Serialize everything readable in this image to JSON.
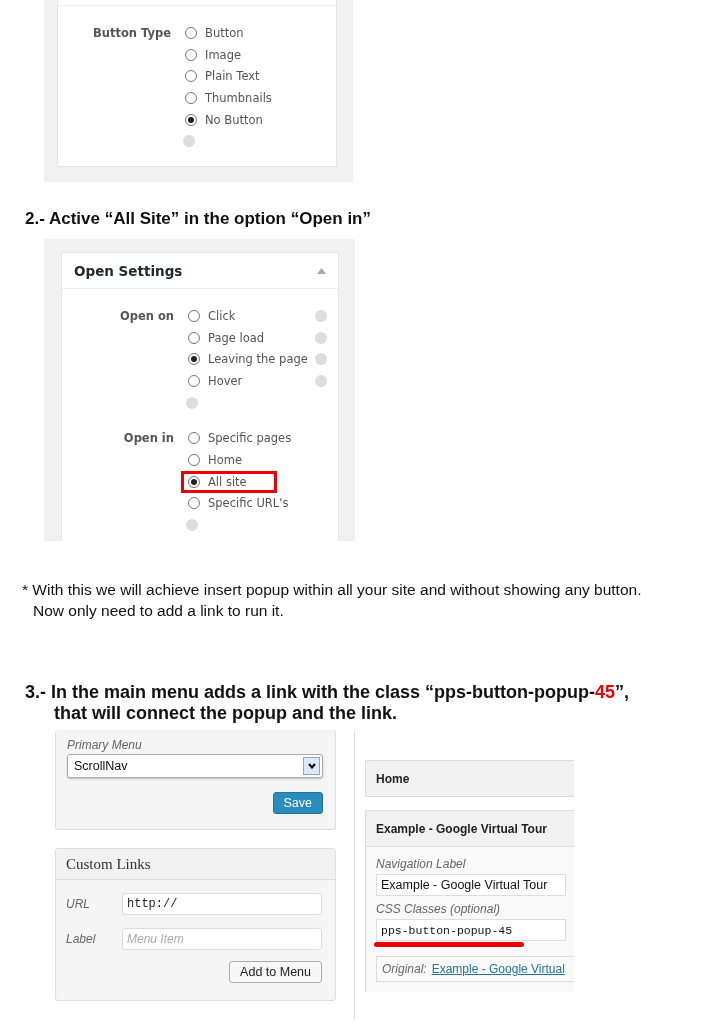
{
  "button_type_panel": {
    "label": "Button Type",
    "options": [
      {
        "label": "Button",
        "selected": false
      },
      {
        "label": "Image",
        "selected": false
      },
      {
        "label": "Plain Text",
        "selected": false
      },
      {
        "label": "Thumbnails",
        "selected": false
      },
      {
        "label": "No Button",
        "selected": true
      }
    ]
  },
  "step_2_heading": "2.- Active “All Site” in the option “Open in”",
  "open_settings_panel": {
    "title": "Open Settings",
    "groups": [
      {
        "label": "Open on",
        "options": [
          {
            "label": "Click",
            "selected": false,
            "highlighted": false
          },
          {
            "label": "Page load",
            "selected": false,
            "highlighted": false
          },
          {
            "label": "Leaving the page",
            "selected": true,
            "highlighted": false
          },
          {
            "label": "Hover",
            "selected": false,
            "highlighted": false
          }
        ],
        "option_help": true
      },
      {
        "label": "Open in",
        "options": [
          {
            "label": "Specific pages",
            "selected": false,
            "highlighted": false
          },
          {
            "label": "Home",
            "selected": false,
            "highlighted": false
          },
          {
            "label": "All site",
            "selected": true,
            "highlighted": true
          },
          {
            "label": "Specific URL's",
            "selected": false,
            "highlighted": false
          }
        ],
        "option_help": false
      }
    ]
  },
  "note": [
    "* With this we will achieve insert popup within all your site and without showing any button.",
    "Now only need to add a link to run it."
  ],
  "step_3_heading": {
    "before": "3.- In the main menu adds a link with the class “pps-button-popup-",
    "highlight": "45",
    "after": "”,",
    "line_2": "that will connect the popup and the link."
  },
  "menu_panel": {
    "label": "Primary Menu",
    "value": "ScrollNav",
    "button": "Save"
  },
  "custom_links": {
    "title": "Custom Links",
    "fields": [
      {
        "label": "URL",
        "value": "http://"
      },
      {
        "label": "Label",
        "placeholder": "Menu Item"
      }
    ],
    "button": "Add to Menu"
  },
  "menu_items": [
    {
      "title": "Home"
    },
    {
      "title": "Example - Google Virtual Tour",
      "navigation_label": "Navigation Label",
      "navigation_value": "Example - Google Virtual Tour",
      "css_label": "CSS Classes (optional)",
      "css_value": "pps-button-popup-45",
      "css_underlined": true,
      "original_label": "Original:",
      "original_link": "Example - Google Virtual"
    }
  ]
}
